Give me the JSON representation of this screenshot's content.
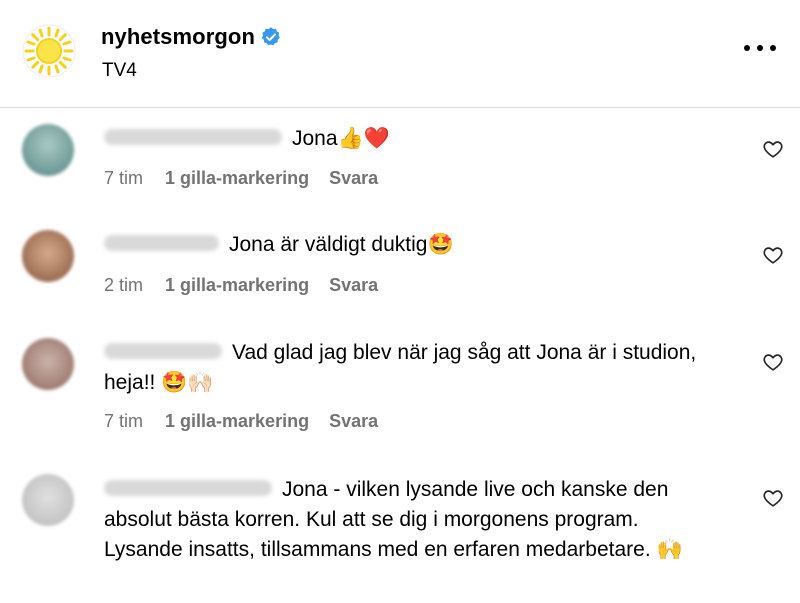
{
  "header": {
    "account_name": "nyhetsmorgon",
    "subtitle": "TV4",
    "avatar_icon": "sun-logo",
    "verified_icon": "verified-badge-icon",
    "verified_color": "#3897f0",
    "more_icon": "more-options-icon"
  },
  "colors": {
    "meta_text": "#737373",
    "divider": "#dbdbdb"
  },
  "comments": [
    {
      "text": "Jona👍❤️",
      "time": "7 tim",
      "likes": "1 gilla-markering",
      "reply": "Svara",
      "avatar_color": "#8fb4b0"
    },
    {
      "text": "Jona är väldigt duktig🤩",
      "time": "2 tim",
      "likes": "1 gilla-markering",
      "reply": "Svara",
      "avatar_color": "#b38a6e"
    },
    {
      "text": "Vad glad jag blev när jag såg att Jona är i studion, heja!! 🤩🙌🏻",
      "time": "7 tim",
      "likes": "1 gilla-markering",
      "reply": "Svara",
      "avatar_color": "#a88d84"
    },
    {
      "text": "Jona - vilken lysande live och kanske den absolut bästa korren. Kul att se dig i morgonens program. Lysande insatts, tillsammans med en erfaren medarbetare. 🙌",
      "avatar_color": "#cfcfcf"
    }
  ]
}
